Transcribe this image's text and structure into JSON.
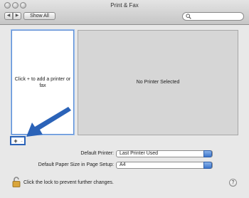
{
  "window": {
    "title": "Print & Fax"
  },
  "toolbar": {
    "back_icon": "◀",
    "forward_icon": "▶",
    "show_all_label": "Show All",
    "search_placeholder": ""
  },
  "printer_list": {
    "hint": "Click + to add a printer or fax"
  },
  "detail": {
    "label": "No Printer Selected"
  },
  "list_controls": {
    "add_label": "+",
    "remove_label": "-"
  },
  "default_printer": {
    "label": "Default Printer:",
    "value": "Last Printer Used"
  },
  "paper_size": {
    "label": "Default Paper Size in Page Setup:",
    "value": "A4"
  },
  "lock": {
    "text": "Click the lock to prevent further changes."
  },
  "help": {
    "label": "?"
  },
  "colors": {
    "accent": "#2b63b8",
    "popup_arrow": "#3d76cc"
  }
}
